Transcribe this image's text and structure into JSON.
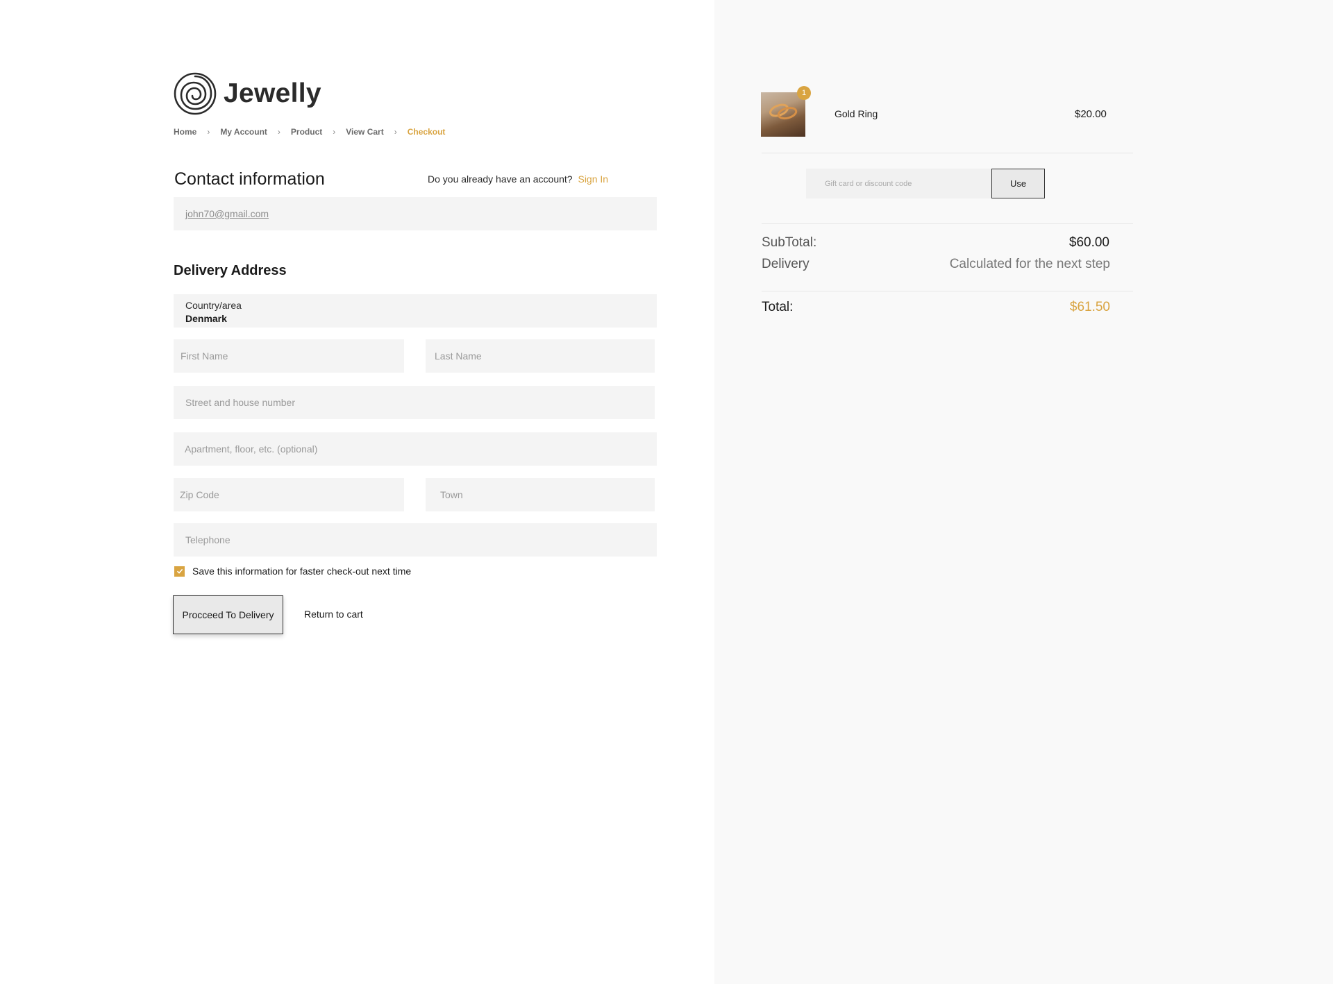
{
  "brand": {
    "name": "Jewelly",
    "logo_icon": "spiral-logo-icon"
  },
  "breadcrumb": {
    "items": [
      "Home",
      "My Account",
      "Product",
      "View Cart"
    ],
    "current": "Checkout",
    "separator": "›"
  },
  "contact": {
    "title": "Contact information",
    "account_question": "Do you already have an account?",
    "sign_in": "Sign In",
    "email_value": "john70@gmail.com"
  },
  "delivery": {
    "title": "Delivery Address",
    "country_label": "Country/area",
    "country_value": "Denmark",
    "first_name_placeholder": "First Name",
    "last_name_placeholder": "Last Name",
    "street_placeholder": "Street and house number",
    "apartment_placeholder": "Apartment, floor, etc. (optional)",
    "zip_placeholder": "Zip Code",
    "town_placeholder": "Town",
    "telephone_placeholder": "Telephone",
    "save_info_label": "Save this information for faster check-out next time",
    "save_info_checked": true
  },
  "actions": {
    "proceed_label": "Procceed To Delivery",
    "return_label": "Return to cart"
  },
  "cart": {
    "item_name": "Gold Ring",
    "item_price": "$20.00",
    "item_quantity": "1",
    "code_placeholder": "Gift card or discount code",
    "use_label": "Use"
  },
  "summary": {
    "subtotal_label": "SubTotal:",
    "subtotal_value": "$60.00",
    "delivery_label": "Delivery",
    "delivery_value": "Calculated for the next step",
    "total_label": "Total:",
    "total_value": "$61.50"
  },
  "colors": {
    "accent": "#d9a441",
    "field_bg": "#f4f4f4",
    "right_panel_bg": "#f9f9f9"
  }
}
